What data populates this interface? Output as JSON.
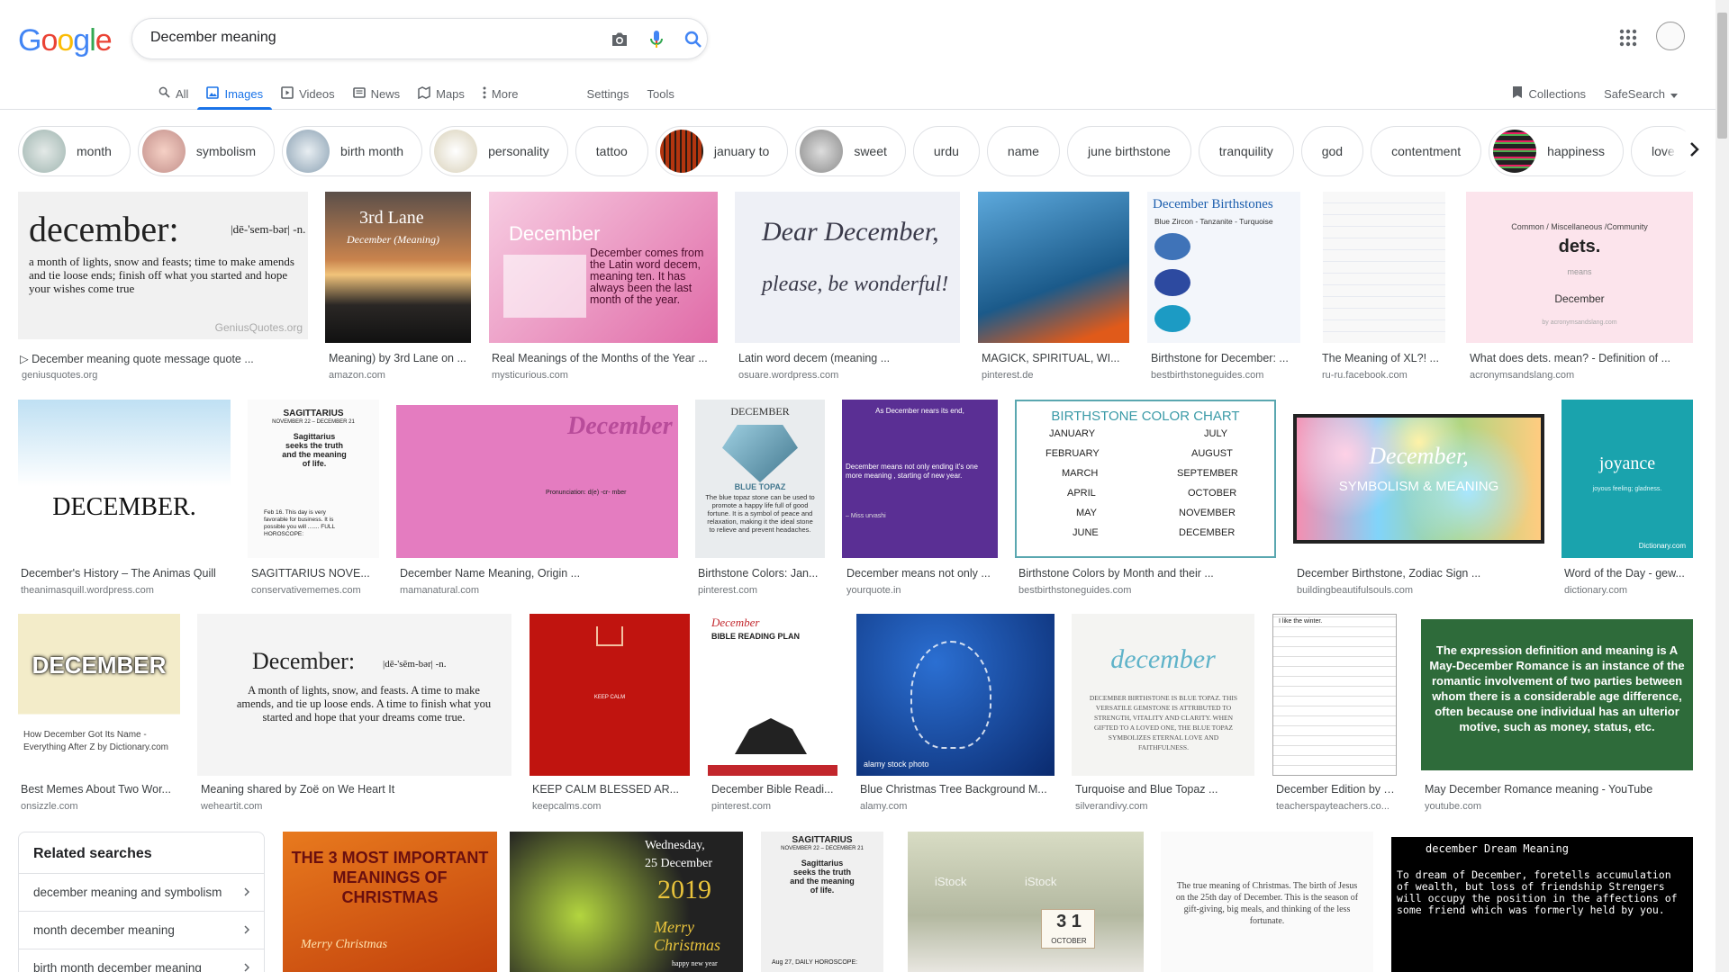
{
  "logo": {
    "letters": [
      "G",
      "o",
      "o",
      "g",
      "l",
      "e"
    ],
    "colors": [
      "#4285f4",
      "#ea4335",
      "#fbbc05",
      "#4285f4",
      "#34a853",
      "#ea4335"
    ]
  },
  "search": {
    "query": "December meaning"
  },
  "tabs": [
    {
      "label": "All",
      "icon": "search-icon"
    },
    {
      "label": "Images",
      "icon": "image-icon"
    },
    {
      "label": "Videos",
      "icon": "play-icon"
    },
    {
      "label": "News",
      "icon": "news-icon"
    },
    {
      "label": "Maps",
      "icon": "map-icon"
    },
    {
      "label": "More",
      "icon": "more-vert-icon"
    }
  ],
  "tools": {
    "settings": "Settings",
    "tools": "Tools"
  },
  "right_tools": {
    "collections": "Collections",
    "safesearch": "SafeSearch"
  },
  "chips": [
    {
      "label": "month",
      "thumb": true
    },
    {
      "label": "symbolism",
      "thumb": true
    },
    {
      "label": "birth month",
      "thumb": true
    },
    {
      "label": "personality",
      "thumb": true
    },
    {
      "label": "tattoo",
      "thumb": false
    },
    {
      "label": "january to",
      "thumb": true
    },
    {
      "label": "sweet",
      "thumb": true
    },
    {
      "label": "urdu",
      "thumb": false
    },
    {
      "label": "name",
      "thumb": false
    },
    {
      "label": "june birthstone",
      "thumb": false
    },
    {
      "label": "tranquility",
      "thumb": false
    },
    {
      "label": "god",
      "thumb": false
    },
    {
      "label": "contentment",
      "thumb": false
    },
    {
      "label": "happiness",
      "thumb": true
    },
    {
      "label": "love",
      "thumb": false
    }
  ],
  "results": [
    {
      "title": "▷ December meaning quote message quote ...",
      "source": "geniusquotes.org"
    },
    {
      "title": "Meaning) by 3rd Lane on ...",
      "source": "amazon.com"
    },
    {
      "title": "Real Meanings of the Months of the Year ...",
      "source": "mysticurious.com"
    },
    {
      "title": "Latin word decem (meaning ...",
      "source": "osuare.wordpress.com"
    },
    {
      "title": "MAGICK, SPIRITUAL, WI...",
      "source": "pinterest.de"
    },
    {
      "title": "Birthstone for December: ...",
      "source": "bestbirthstoneguides.com"
    },
    {
      "title": "The Meaning of XL?! ...",
      "source": "ru-ru.facebook.com"
    },
    {
      "title": "What does dets. mean? - Definition of ...",
      "source": "acronymsandslang.com"
    },
    {
      "title": "December's History – The Animas Quill",
      "source": "theanimasquill.wordpress.com"
    },
    {
      "title": "SAGITTARIUS NOVE...",
      "source": "conservativememes.com"
    },
    {
      "title": "December Name Meaning, Origin ...",
      "source": "mamanatural.com"
    },
    {
      "title": "Birthstone Colors: Jan...",
      "source": "pinterest.com"
    },
    {
      "title": "December means not only ...",
      "source": "yourquote.in"
    },
    {
      "title": "Birthstone Colors by Month and their ...",
      "source": "bestbirthstoneguides.com"
    },
    {
      "title": "December Birthstone, Zodiac Sign ...",
      "source": "buildingbeautifulsouls.com"
    },
    {
      "title": "Word of the Day - gew...",
      "source": "dictionary.com"
    },
    {
      "title": "Best Memes About Two Wor...",
      "source": "onsizzle.com"
    },
    {
      "title": "Meaning shared by Zoë on We Heart It",
      "source": "weheartit.com"
    },
    {
      "title": "KEEP CALM BLESSED AR...",
      "source": "keepcalms.com"
    },
    {
      "title": "December Bible Readi...",
      "source": "pinterest.com"
    },
    {
      "title": "Blue Christmas Tree Background M...",
      "source": "alamy.com"
    },
    {
      "title": "Turquoise and Blue Topaz ...",
      "source": "silverandivy.com"
    },
    {
      "title": "December Edition by T...",
      "source": "teacherspayteachers.co..."
    },
    {
      "title": "May December Romance meaning - YouTube",
      "source": "youtube.com"
    }
  ],
  "overlays": {
    "dict_word": "december:",
    "dict_pron": "|dē-'sem-bər| -n.",
    "dict_def": "a month of lights, snow and feasts; time to make amends and tie loose ends; finish off what you started and hope your wishes come true",
    "dict_brand": "GeniusQuotes.org",
    "third_lane": "3rd Lane",
    "third_lane_sub": "December (Meaning)",
    "dec_pink_title": "December",
    "dec_pink_body": "December comes from the Latin word decem, meaning ten. It has always been the last month of the year.",
    "dear_dec": "Dear December,",
    "dear_dec_2": "please, be wonderful!",
    "bday_title": "December Birthstones",
    "bday_sub": "Blue Zircon - Tanzanite - Turquoise",
    "dets_cat": "Common / Miscellaneous /Community",
    "dets_word": "dets.",
    "dets_means": "means",
    "dets_val": "December",
    "dets_footer": "by acronymsandslang.com",
    "icicle_word": "DECEMBER.",
    "sag_title": "SAGITTARIUS",
    "sag_dates": "NOVEMBER 22 – DECEMBER 21",
    "sag_text": "Sagittarius seeks the truth and the meaning of life.",
    "sag_horoscope": "Feb 16. This day is very favorable for business. It is possible you will ....... FULL HOROSCOPE:",
    "mama_word": "December",
    "mama_pron": "Pronunciation: d(e) -cr- mber",
    "topaz_head": "DECEMBER",
    "topaz_label": "BLUE TOPAZ",
    "topaz_text": "The blue topaz stone can be used to promote a happy life full of good fortune. It is a symbol of peace and relaxation, making it the ideal stone to relieve and prevent headaches.",
    "yq_head": "As December nears its end,",
    "yq_text": "December means not only ending it's one more meaning , starting of new year.",
    "yq_author": "– Miss urvashi",
    "chart_title": "BIRTHSTONE COLOR CHART",
    "chart_rows": [
      "JANUARY",
      "FEBRUARY",
      "MARCH",
      "APRIL",
      "MAY",
      "JUNE",
      "JULY",
      "AUGUST",
      "SEPTEMBER",
      "OCTOBER",
      "NOVEMBER",
      "DECEMBER"
    ],
    "bokeh_title": "December,",
    "bokeh_sub": "SYMBOLISM & MEANING",
    "joy_word": "joyance",
    "joy_def": "joyous feeling; gladness.",
    "joy_brand": "Dictionary.com",
    "meme_word": "DECEMBER",
    "meme_caption": "How December Got Its Name - Everything After Z by Dictionary.com",
    "whi_word": "December:",
    "whi_pron": "|dē-'sĕm-bər| -n.",
    "whi_def": "A month of lights, snow, and feasts. A time to make amends, and tie up loose ends. A time to finish what you started and hope that your dreams come true.",
    "kc_text": "KEEP CALM",
    "bible_title": "December",
    "bible_sub": "BIBLE READING PLAN",
    "alamy": "alamy stock photo",
    "silver_word": "december",
    "silver_text": "DECEMBER BIRTHSTONE IS BLUE TOPAZ. THIS VERSATILE GEMSTONE IS ATTRIBUTED TO STRENGTH, VITALITY AND CLARITY. WHEN GIFTED TO A LOVED ONE, THE BLUE TOPAZ SYMBOLIZES ETERNAL LOVE AND FAITHFULNESS.",
    "tpt_head": "I like the winter.",
    "romance_text": "The expression definition and meaning is A May-December Romance is an instance of the romantic involvement of two parties between whom there is a considerable age difference, often because one individual has an ulterior motive, such as money, status, etc.",
    "xmas_text": "THE 3 MOST IMPORTANT MEANINGS OF CHRISTMAS",
    "xmas_script": "Merry Christmas",
    "wed_day": "Wednesday,",
    "wed_date": "25 December",
    "wed_year": "2019",
    "wed_merry": "Merry Christmas",
    "wed_happy": "happy new year",
    "sag2_title": "SAGITTARIUS",
    "sag2_dates": "NOVEMBER 22 – DECEMBER 21",
    "sag2_text": "Sagittarius seeks the truth and the meaning of life.",
    "sag2_horo": "Aug 27, DAILY HOROSCOPE:",
    "istock": "iStock",
    "cal_num": "3 1",
    "cal_month": "OCTOBER",
    "truemean": "The true meaning of Christmas. The birth of Jesus on the 25th day of December. This is the season of gift-giving, big meals, and thinking of the less fortunate.",
    "dream_title": "december Dream Meaning",
    "dream_text": "To dream of December, foretells accumulation of wealth, but loss of friendship Strengers will occupy the position in the affections of some friend which was formerly held by you."
  },
  "related": {
    "title": "Related searches",
    "items": [
      "december meaning and symbolism",
      "month december meaning",
      "birth month december meaning"
    ]
  }
}
